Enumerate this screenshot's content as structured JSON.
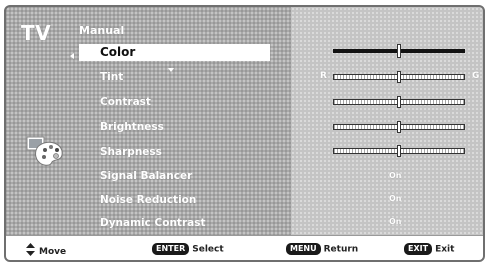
{
  "header": {
    "tv_label": "TV",
    "section": "Manual"
  },
  "menu": [
    {
      "label": "Color",
      "selected": true
    },
    {
      "label": "Tint",
      "selected": false
    },
    {
      "label": "Contrast",
      "selected": false
    },
    {
      "label": "Brightness",
      "selected": false
    },
    {
      "label": "Sharpness",
      "selected": false
    },
    {
      "label": "Signal Balancer",
      "selected": false
    },
    {
      "label": "Noise Reduction",
      "selected": false
    },
    {
      "label": "Dynamic Contrast",
      "selected": false
    }
  ],
  "values": {
    "color_level": 0.5,
    "tint_level": 0.5,
    "tint_left_label": "R",
    "tint_right_label": "G",
    "contrast_level": 0.5,
    "brightness_level": 0.5,
    "sharpness_level": 0.5,
    "signal_balancer": "On",
    "noise_reduction": "On",
    "dynamic_contrast": "On"
  },
  "footer": {
    "move_label": "Move",
    "enter_key": "ENTER",
    "enter_label": "Select",
    "menu_key": "MENU",
    "menu_label": "Return",
    "exit_key": "EXIT",
    "exit_label": "Exit"
  },
  "icons": [
    "picture-settings-icon",
    "updown-arrows-icon",
    "left-arrow-icon",
    "down-arrow-icon"
  ]
}
